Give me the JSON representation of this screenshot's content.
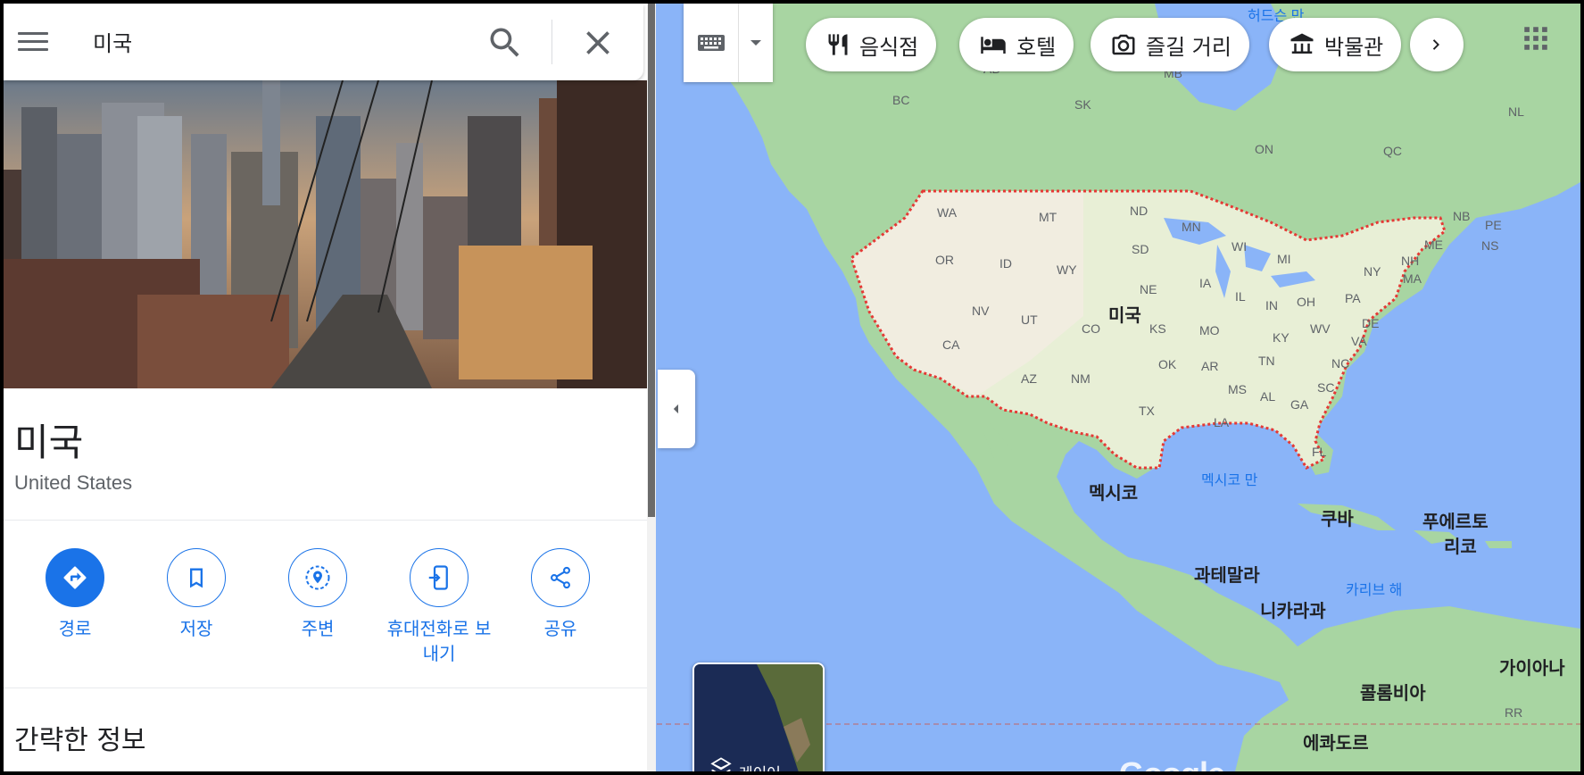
{
  "search": {
    "query": "미국",
    "menu_icon": "hamburger-menu-icon",
    "search_icon": "search-icon",
    "close_icon": "close-icon"
  },
  "place": {
    "title": "미국",
    "subtitle": "United States"
  },
  "actions": [
    {
      "label": "경로",
      "icon": "directions-icon"
    },
    {
      "label": "저장",
      "icon": "bookmark-icon"
    },
    {
      "label": "주변",
      "icon": "nearby-icon"
    },
    {
      "label": "휴대전화로 보\n내기",
      "icon": "send-to-phone-icon"
    },
    {
      "label": "공유",
      "icon": "share-icon"
    }
  ],
  "section": {
    "title": "간략한 정보"
  },
  "chips": [
    {
      "label": "음식점",
      "icon": "restaurant-icon"
    },
    {
      "label": "호텔",
      "icon": "hotel-icon"
    },
    {
      "label": "즐길 거리",
      "icon": "camera-icon"
    },
    {
      "label": "박물관",
      "icon": "museum-icon"
    }
  ],
  "layers": {
    "label": "레이어"
  },
  "map_labels": {
    "countries": {
      "usa": "미국",
      "mexico": "멕시코",
      "cuba": "쿠바",
      "puerto_rico_1": "푸에르토",
      "puerto_rico_2": "리코",
      "guatemala": "과테말라",
      "nicaragua": "니카라과",
      "colombia": "콜롬비아",
      "guyana": "가이아나",
      "ecuador": "에콰도르"
    },
    "water": {
      "gulf": "멕시코 만",
      "caribbean": "카리브 해",
      "hudson": "허드슨 만"
    },
    "canada": [
      "AB",
      "MB",
      "BC",
      "SK",
      "ON",
      "QC",
      "NL",
      "NB",
      "PE",
      "NS"
    ],
    "states": [
      "WA",
      "MT",
      "ND",
      "MN",
      "WI",
      "MI",
      "OR",
      "ID",
      "WY",
      "SD",
      "IA",
      "NE",
      "IL",
      "IN",
      "OH",
      "PA",
      "NY",
      "NH",
      "MA",
      "ME",
      "NV",
      "UT",
      "CO",
      "KS",
      "MO",
      "KY",
      "WV",
      "DE",
      "VA",
      "CA",
      "AZ",
      "NM",
      "OK",
      "AR",
      "TN",
      "NC",
      "MS",
      "AL",
      "SC",
      "GA",
      "TX",
      "LA",
      "FL",
      "RR"
    ]
  },
  "colors": {
    "water": "#8ab4f8",
    "land_green": "#a8d5a2",
    "land_light": "#f1ede0",
    "border_red": "#e53935",
    "accent_blue": "#1a73e8"
  }
}
